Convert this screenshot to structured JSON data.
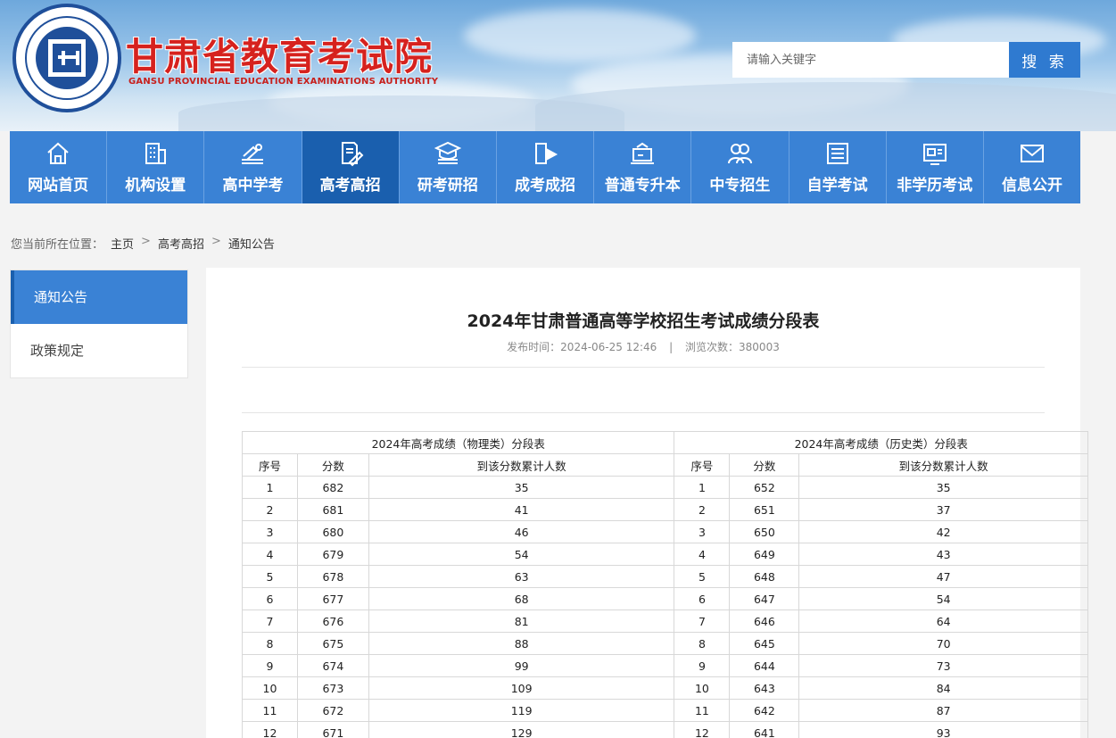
{
  "header": {
    "title": "甘肃省教育考试院",
    "subtitle": "GANSU PROVINCIAL EDUCATION EXAMINATIONS AUTHORITY",
    "search_placeholder": "请输入关键字",
    "search_button": "搜 索"
  },
  "nav": [
    {
      "label": "网站首页",
      "icon": "home-icon"
    },
    {
      "label": "机构设置",
      "icon": "building-icon"
    },
    {
      "label": "高中学考",
      "icon": "books-icon"
    },
    {
      "label": "高考高招",
      "icon": "document-pen-icon",
      "active": true
    },
    {
      "label": "研考研招",
      "icon": "graduation-cap-icon"
    },
    {
      "label": "成考成招",
      "icon": "book-flag-icon"
    },
    {
      "label": "普通专升本",
      "icon": "laptop-cap-icon"
    },
    {
      "label": "中专招生",
      "icon": "users-icon"
    },
    {
      "label": "自学考试",
      "icon": "list-icon"
    },
    {
      "label": "非学历考试",
      "icon": "id-card-icon"
    },
    {
      "label": "信息公开",
      "icon": "mail-icon"
    }
  ],
  "breadcrumb": {
    "prefix": "您当前所在位置：",
    "items": [
      "主页",
      "高考高招",
      "通知公告"
    ],
    "separator": ">"
  },
  "sidebar": {
    "items": [
      {
        "label": "通知公告",
        "active": true
      },
      {
        "label": "政策规定",
        "active": false
      }
    ]
  },
  "article": {
    "title": "2024年甘肃普通高等学校招生考试成绩分段表",
    "published_label": "发布时间：",
    "published": "2024-06-25 12:46",
    "views_label": "浏览次数：",
    "views": "380003",
    "meta_separator": "|"
  },
  "table": {
    "physics_title": "2024年高考成绩（物理类）分段表",
    "history_title": "2024年高考成绩（历史类）分段表",
    "headers": [
      "序号",
      "分数",
      "到该分数累计人数"
    ],
    "rows": [
      {
        "p": [
          "1",
          "682",
          "35"
        ],
        "h": [
          "1",
          "652",
          "35"
        ]
      },
      {
        "p": [
          "2",
          "681",
          "41"
        ],
        "h": [
          "2",
          "651",
          "37"
        ]
      },
      {
        "p": [
          "3",
          "680",
          "46"
        ],
        "h": [
          "3",
          "650",
          "42"
        ]
      },
      {
        "p": [
          "4",
          "679",
          "54"
        ],
        "h": [
          "4",
          "649",
          "43"
        ]
      },
      {
        "p": [
          "5",
          "678",
          "63"
        ],
        "h": [
          "5",
          "648",
          "47"
        ]
      },
      {
        "p": [
          "6",
          "677",
          "68"
        ],
        "h": [
          "6",
          "647",
          "54"
        ]
      },
      {
        "p": [
          "7",
          "676",
          "81"
        ],
        "h": [
          "7",
          "646",
          "64"
        ]
      },
      {
        "p": [
          "8",
          "675",
          "88"
        ],
        "h": [
          "8",
          "645",
          "70"
        ]
      },
      {
        "p": [
          "9",
          "674",
          "99"
        ],
        "h": [
          "9",
          "644",
          "73"
        ]
      },
      {
        "p": [
          "10",
          "673",
          "109"
        ],
        "h": [
          "10",
          "643",
          "84"
        ]
      },
      {
        "p": [
          "11",
          "672",
          "119"
        ],
        "h": [
          "11",
          "642",
          "87"
        ]
      },
      {
        "p": [
          "12",
          "671",
          "129"
        ],
        "h": [
          "12",
          "641",
          "93"
        ]
      }
    ]
  },
  "colors": {
    "nav_bg": "#3a82d5",
    "nav_active": "#1a5fae",
    "title_red": "#d6221e",
    "search_btn": "#2f7ad0"
  }
}
